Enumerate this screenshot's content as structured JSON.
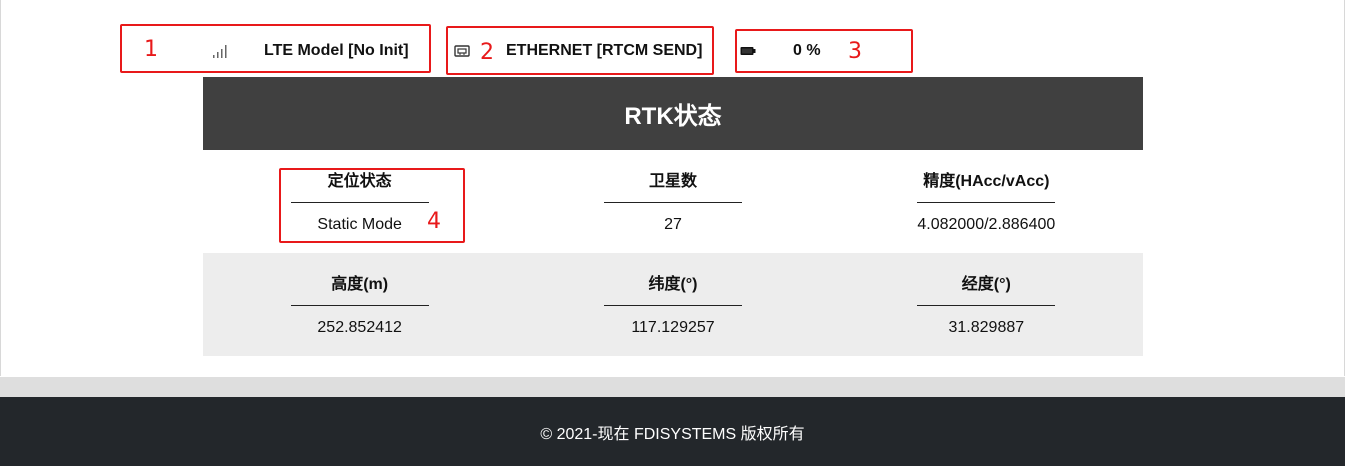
{
  "status_bar": {
    "lte_label": "LTE Model [No Init]",
    "ethernet_label": "ETHERNET [RTCM SEND]",
    "battery_label": "0 %",
    "lte_icon": "signal-bars-icon",
    "ethernet_icon": "ethernet-port-icon",
    "battery_icon": "battery-icon"
  },
  "annotations": [
    "1",
    "2",
    "3",
    "4"
  ],
  "rtk": {
    "title": "RTK状态",
    "rows": [
      {
        "cells": [
          {
            "title": "定位状态",
            "value": "Static Mode"
          },
          {
            "title": "卫星数",
            "value": "27"
          },
          {
            "title": "精度(HAcc/vAcc)",
            "value": "4.082000/2.886400"
          }
        ]
      },
      {
        "cells": [
          {
            "title": "高度(m)",
            "value": "252.852412"
          },
          {
            "title": "纬度(°)",
            "value": "117.129257"
          },
          {
            "title": "经度(°)",
            "value": "31.829887"
          }
        ]
      }
    ]
  },
  "footer": {
    "text": "© 2021-现在 FDISYSTEMS 版权所有"
  },
  "colors": {
    "header_bg": "#404040",
    "footer_bg": "#23272b",
    "annotation": "#e8191a",
    "row_alt_bg": "#ededed"
  }
}
